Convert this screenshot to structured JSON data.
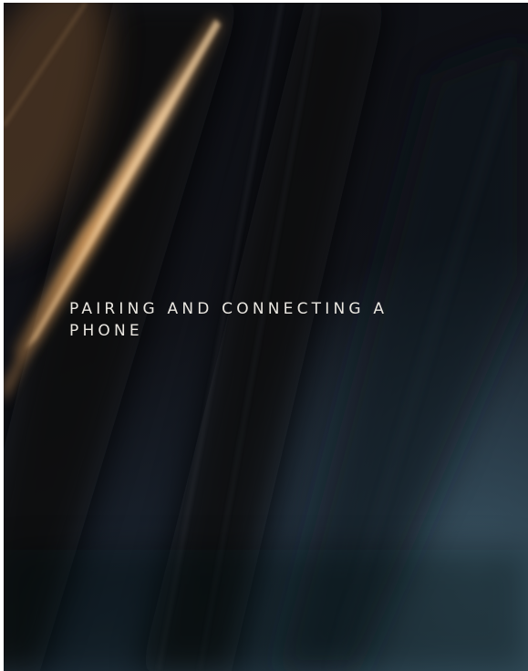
{
  "document": {
    "title_lines": [
      "PAIRING AND CONNECTING A",
      "PHONE"
    ]
  },
  "colors": {
    "background_dark": "#0c0d12",
    "background_teal": "#2a3c49",
    "light_streak": "#e3a866",
    "title_text": "#e9e6e0"
  }
}
